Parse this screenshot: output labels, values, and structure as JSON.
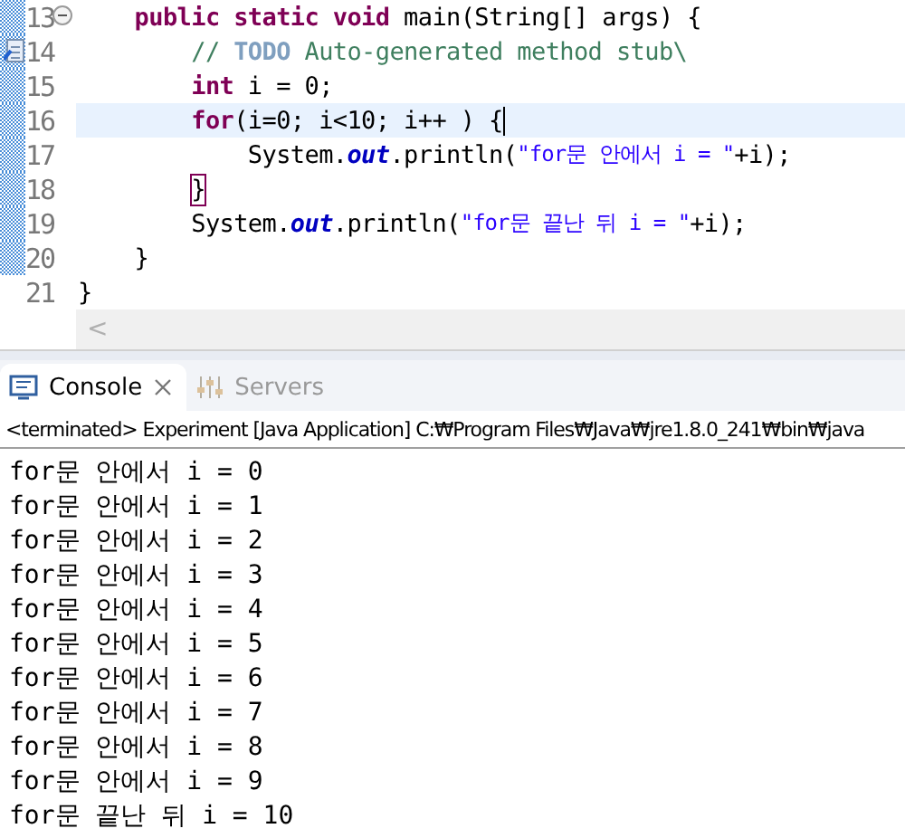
{
  "editor": {
    "lines": [
      {
        "number": "13",
        "kind": "fold",
        "changed": true,
        "current": false,
        "tokens": [
          {
            "kind": "keyword",
            "text": "    public static void"
          },
          {
            "kind": "plain",
            "text": " main(String[] args) {"
          }
        ]
      },
      {
        "number": "14",
        "kind": "task",
        "changed": true,
        "current": false,
        "tokens": [
          {
            "kind": "comment",
            "text": "        // "
          },
          {
            "kind": "todo",
            "text": "TODO"
          },
          {
            "kind": "comment",
            "text": " Auto-generated method stub\\"
          }
        ]
      },
      {
        "number": "15",
        "kind": "plain",
        "changed": true,
        "current": false,
        "tokens": [
          {
            "kind": "keyword",
            "text": "        int"
          },
          {
            "kind": "plain",
            "text": " i = 0;"
          }
        ]
      },
      {
        "number": "16",
        "kind": "plain",
        "changed": true,
        "current": true,
        "tokens": [
          {
            "kind": "keyword",
            "text": "        for"
          },
          {
            "kind": "plain",
            "text": "(i=0; i<10; i++ ) {"
          }
        ]
      },
      {
        "number": "17",
        "kind": "plain",
        "changed": true,
        "current": false,
        "tokens": [
          {
            "kind": "plain",
            "text": "            System."
          },
          {
            "kind": "field",
            "text": "out"
          },
          {
            "kind": "plain",
            "text": ".println("
          },
          {
            "kind": "string",
            "text": "\"for문 안에서 i = \""
          },
          {
            "kind": "plain",
            "text": "+i);"
          }
        ]
      },
      {
        "number": "18",
        "kind": "plain",
        "changed": true,
        "current": false,
        "tokens": [
          {
            "kind": "match",
            "text": "        }"
          }
        ]
      },
      {
        "number": "19",
        "kind": "plain",
        "changed": true,
        "current": false,
        "tokens": [
          {
            "kind": "plain",
            "text": "        System."
          },
          {
            "kind": "field",
            "text": "out"
          },
          {
            "kind": "plain",
            "text": ".println("
          },
          {
            "kind": "string",
            "text": "\"for문 끝난 뒤 i = \""
          },
          {
            "kind": "plain",
            "text": "+i);"
          }
        ]
      },
      {
        "number": "20",
        "kind": "plain",
        "changed": true,
        "current": false,
        "tokens": [
          {
            "kind": "plain",
            "text": "    }"
          }
        ]
      },
      {
        "number": "21",
        "kind": "plain",
        "changed": false,
        "current": false,
        "tokens": [
          {
            "kind": "plain",
            "text": "}"
          }
        ]
      }
    ],
    "scroll_arrow": "<"
  },
  "console": {
    "tabs": [
      {
        "label": "Console",
        "selected": true
      },
      {
        "label": "Servers",
        "selected": false
      }
    ],
    "status": "<terminated> Experiment [Java Application] C:₩Program Files₩Java₩jre1.8.0_241₩bin₩java",
    "output": [
      "for문 안에서 i = 0",
      "for문 안에서 i = 1",
      "for문 안에서 i = 2",
      "for문 안에서 i = 3",
      "for문 안에서 i = 4",
      "for문 안에서 i = 5",
      "for문 안에서 i = 6",
      "for문 안에서 i = 7",
      "for문 안에서 i = 8",
      "for문 안에서 i = 9",
      "for문 끝난 뒤 i = 10"
    ]
  }
}
